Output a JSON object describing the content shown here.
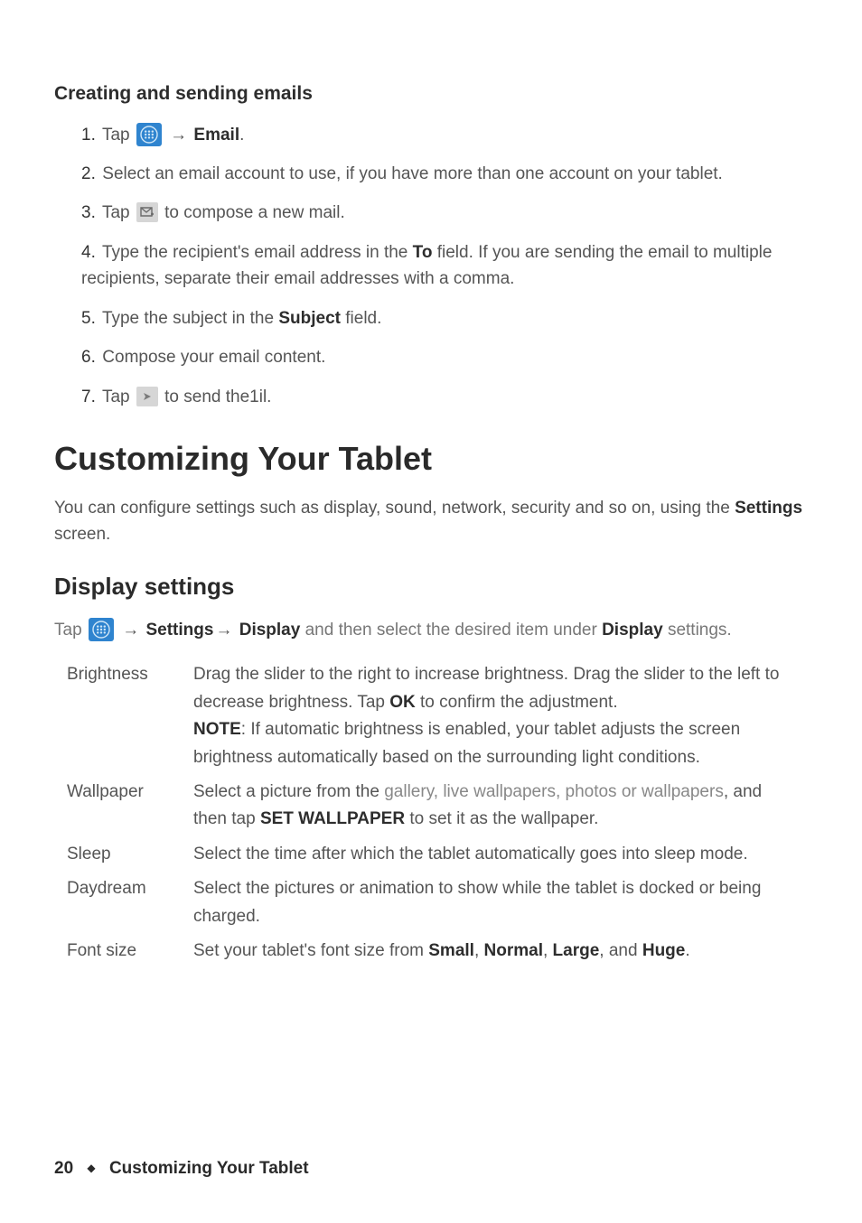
{
  "emails_heading": "Creating and sending emails",
  "steps": {
    "s1a": "1.",
    "s1_tap": "Tap ",
    "s1_arrow": " → ",
    "s1_email": "Email",
    "s1_period": ".",
    "s2a": "2.",
    "s2": "Select an email account to use, if you have more than one account on your tablet.",
    "s3a": "3.",
    "s3_tap": "Tap ",
    "s3_rest": " to compose a new mail.",
    "s4a": "4.",
    "s4_a": "Type the recipient's email address in the ",
    "s4_to": "To",
    "s4_b": " field. If you are sending the email to multiple recipients, separate their email addresses with a comma.",
    "s5a": "5.",
    "s5_a": "Type the subject in the ",
    "s5_subject": "Subject",
    "s5_b": " field.",
    "s6a": "6.",
    "s6": "Compose your email content.",
    "s7a": "7.",
    "s7_tap": "Tap ",
    "s7_rest": " to send the1il."
  },
  "customize_heading": "Customizing Your Tablet",
  "customize_lead_a": "You can configure settings such as display, sound, network, security and so on, using the ",
  "customize_lead_settings": "Settings",
  "customize_lead_b": " screen.",
  "display_heading": "Display settings",
  "display_intro": {
    "tap": "Tap ",
    "arrow1": " → ",
    "settings": "Settings",
    "arrow2": "→ ",
    "display": "Display",
    "mid": " and then select the desired item under ",
    "display2": "Display",
    "end": " settings."
  },
  "table": {
    "brightness_label": "Brightness",
    "brightness_a": "Drag the slider to the right to increase brightness. Drag the slider to the left to decrease brightness. Tap ",
    "brightness_ok": "OK",
    "brightness_b": " to confirm the adjustment.",
    "brightness_note": "NOTE",
    "brightness_note_rest": ": If automatic brightness is enabled, your tablet adjusts the screen brightness automatically based on the surrounding light conditions.",
    "wallpaper_label": "Wallpaper",
    "wallpaper_a": "Select a picture from the ",
    "wallpaper_gray": "gallery, live wallpapers, photos or wallpapers",
    "wallpaper_b": ", and then tap ",
    "wallpaper_set": "SET WALLPAPER",
    "wallpaper_c": " to set it as the wallpaper.",
    "sleep_label": "Sleep",
    "sleep_body": "Select the time after which the tablet automatically goes into sleep mode.",
    "daydream_label": "Daydream",
    "daydream_body": "Select the pictures or animation to show while the tablet is docked or being charged.",
    "fontsize_label": "Font size",
    "fontsize_a": "Set your tablet's font size from ",
    "fs_small": "Small",
    "fs_c1": ", ",
    "fs_normal": "Normal",
    "fs_c2": ", ",
    "fs_large": "Large",
    "fs_c3": ", and ",
    "fs_huge": "Huge",
    "fs_end": "."
  },
  "footer": {
    "page": "20",
    "title": "Customizing Your Tablet"
  }
}
